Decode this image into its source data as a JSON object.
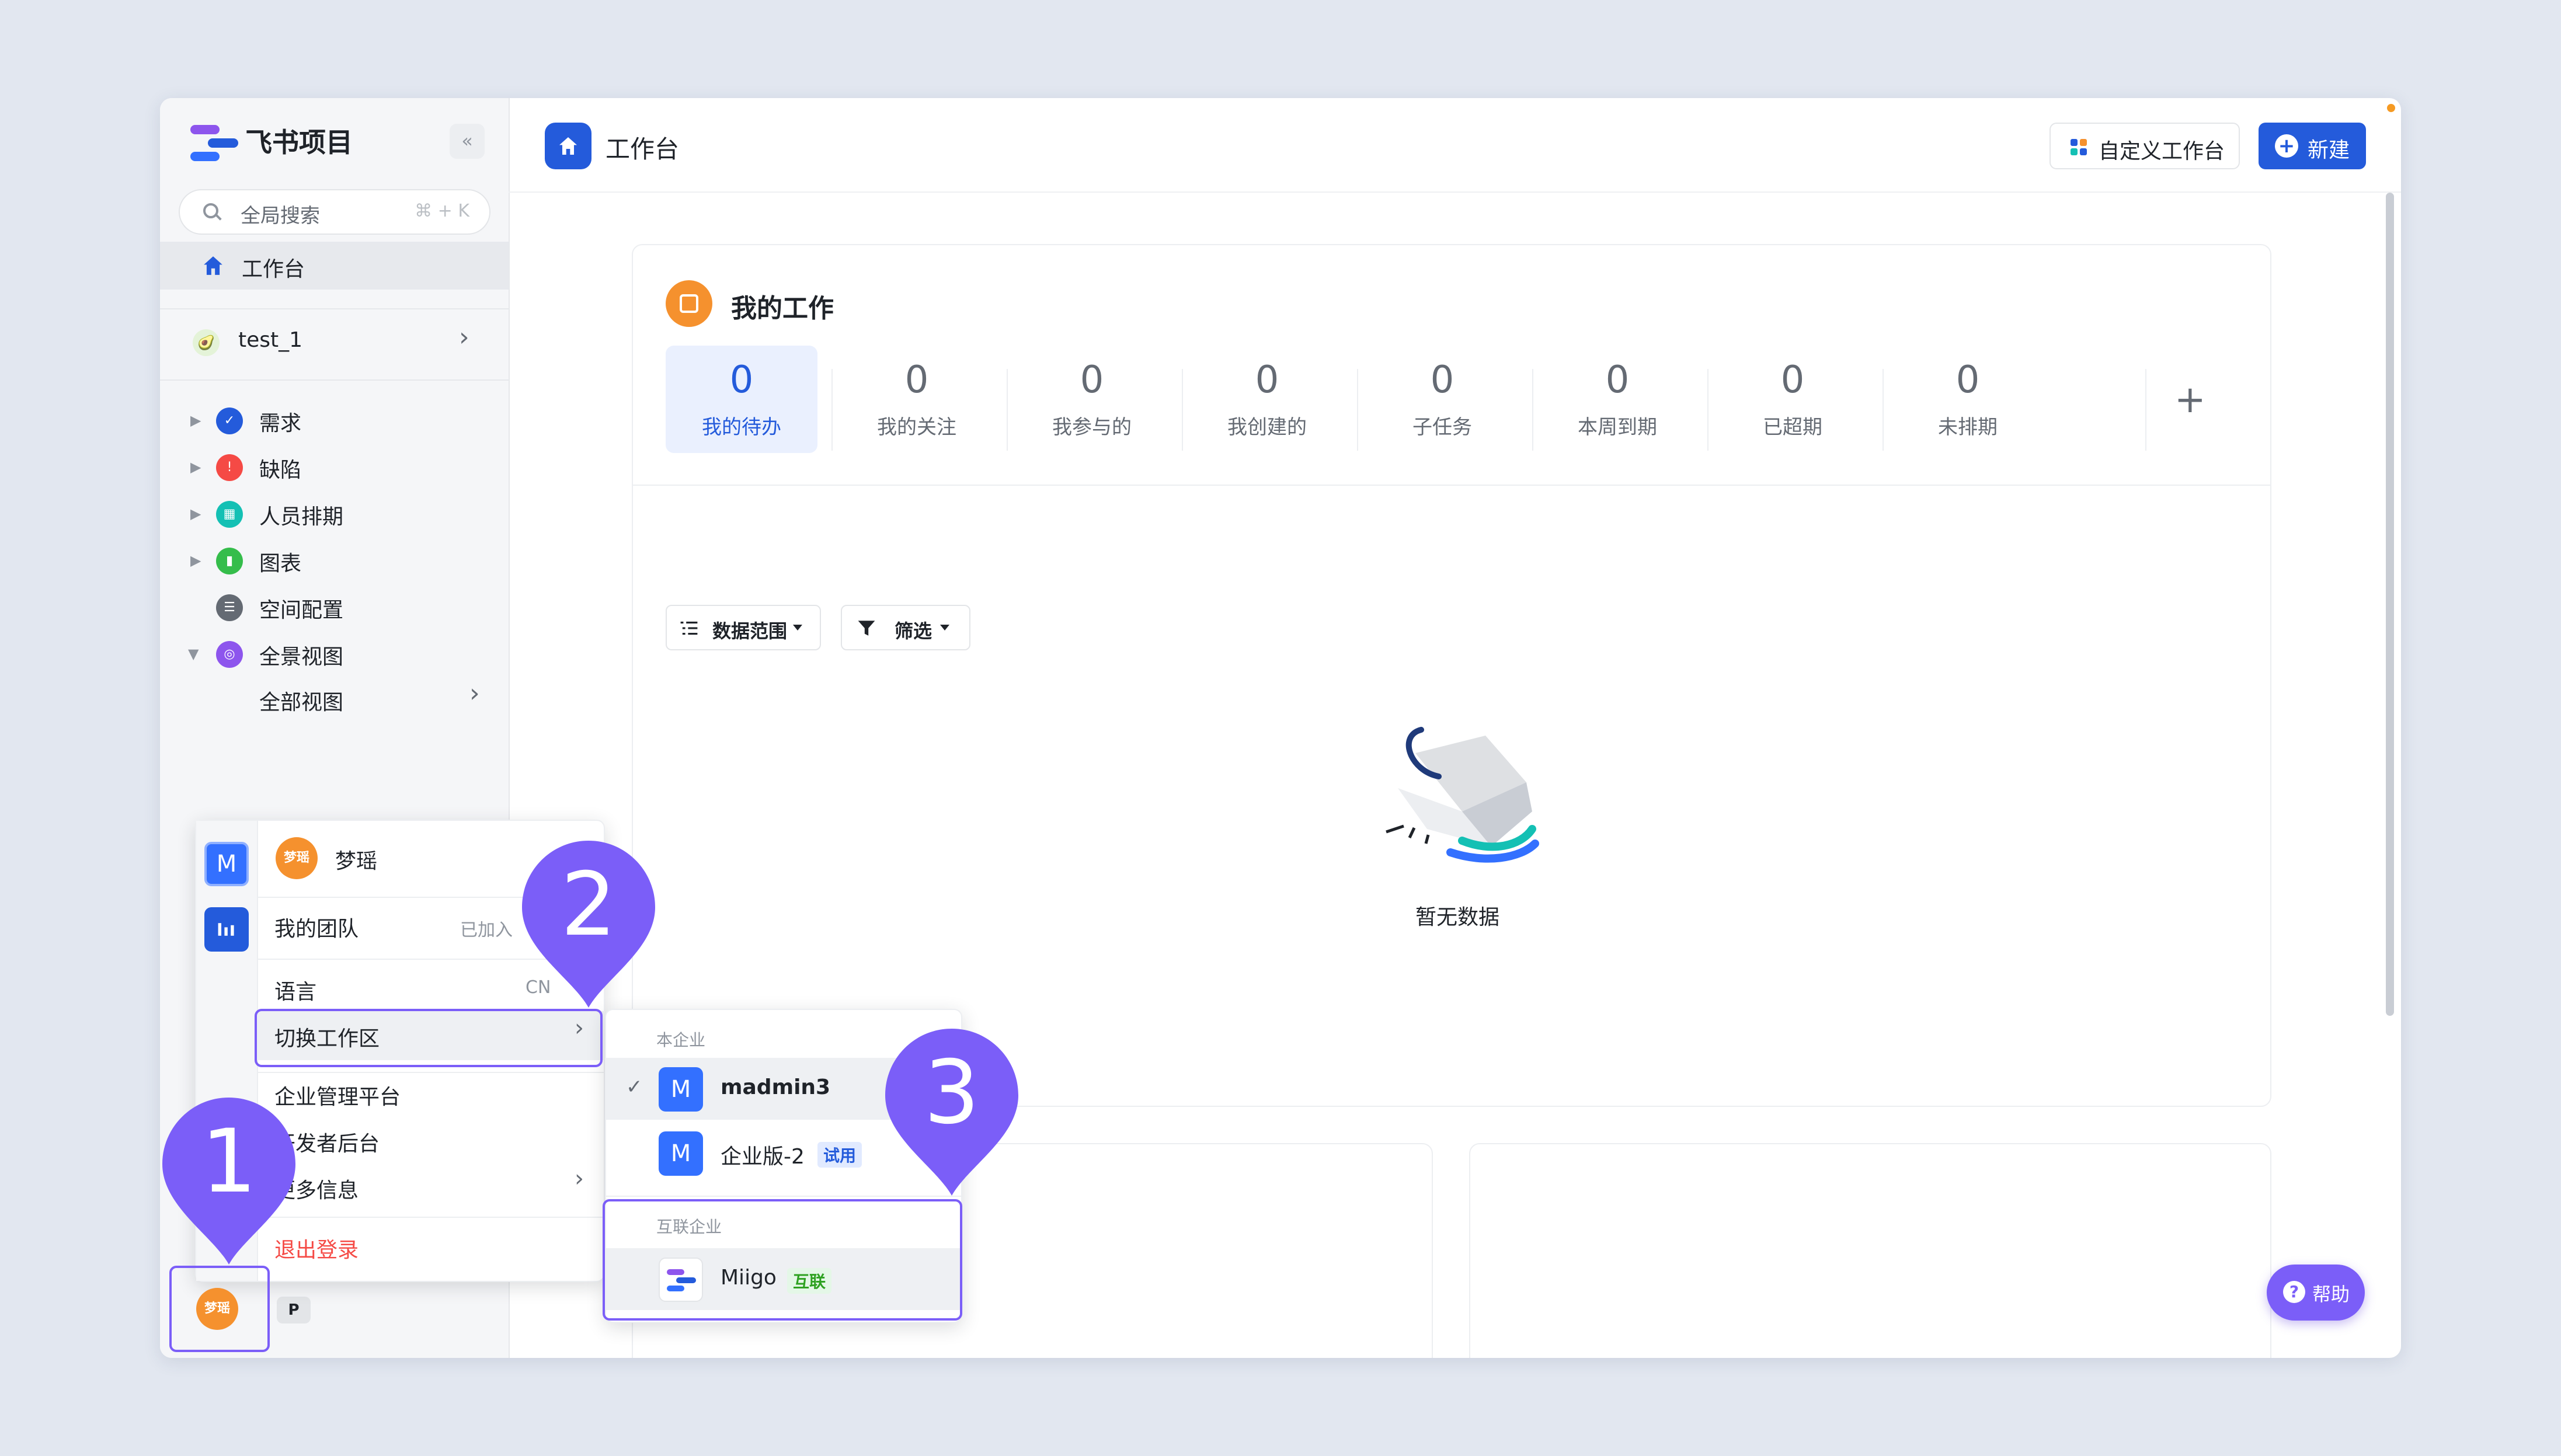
{
  "sidebar": {
    "brand": "飞书项目",
    "collapse": "«",
    "search_placeholder": "全局搜索",
    "search_shortcut": "⌘ + K",
    "workbench": "工作台",
    "space_name": "test_1",
    "tree": [
      {
        "label": "需求",
        "icon": "check-circle-icon",
        "color": "#245bdb"
      },
      {
        "label": "缺陷",
        "icon": "alert-icon",
        "color": "#f54a45"
      },
      {
        "label": "人员排期",
        "icon": "calendar-icon",
        "color": "#14c0b4"
      },
      {
        "label": "图表",
        "icon": "chart-icon",
        "color": "#35bd4b"
      },
      {
        "label": "空间配置",
        "icon": "settings-icon",
        "color": "#646a73"
      },
      {
        "label": "全景视图",
        "icon": "panorama-icon",
        "color": "#8d55ed"
      }
    ],
    "all_views": "全部视图",
    "user_avatar": "梦瑶",
    "p_badge": "P"
  },
  "header": {
    "title": "工作台",
    "customize": "自定义工作台",
    "new": "新建"
  },
  "my_work": {
    "title": "我的工作",
    "stats": [
      {
        "value": "0",
        "label": "我的待办"
      },
      {
        "value": "0",
        "label": "我的关注"
      },
      {
        "value": "0",
        "label": "我参与的"
      },
      {
        "value": "0",
        "label": "我创建的"
      },
      {
        "value": "0",
        "label": "子任务"
      },
      {
        "value": "0",
        "label": "本周到期"
      },
      {
        "value": "0",
        "label": "已超期"
      },
      {
        "value": "0",
        "label": "未排期"
      }
    ],
    "add": "+",
    "scope_filter": "数据范围",
    "filter": "筛选",
    "empty": "暂无数据"
  },
  "user_menu": {
    "ws_tile_1": "M",
    "user_name": "梦瑶",
    "my_team": "我的团队",
    "joined": "已加入",
    "language": "语言",
    "language_value": "CN",
    "switch_workspace": "切换工作区",
    "admin_platform": "企业管理平台",
    "developer_console": "开发者后台",
    "more_info": "更多信息",
    "logout": "退出登录"
  },
  "workspace_menu": {
    "own_section": "本企业",
    "own": [
      {
        "tile": "M",
        "name": "madmin3",
        "tag": ""
      },
      {
        "tile": "M",
        "name": "企业版-2",
        "tag": "试用"
      }
    ],
    "linked_section": "互联企业",
    "linked": [
      {
        "name": "Miigo",
        "tag": "互联"
      }
    ]
  },
  "callouts": [
    "1",
    "2",
    "3"
  ],
  "help": "帮助",
  "colors": {
    "brand_blue": "#245bdb",
    "callout_purple": "#7b5ef8",
    "avatar_orange": "#f5912e",
    "logout_red": "#f54a45"
  }
}
